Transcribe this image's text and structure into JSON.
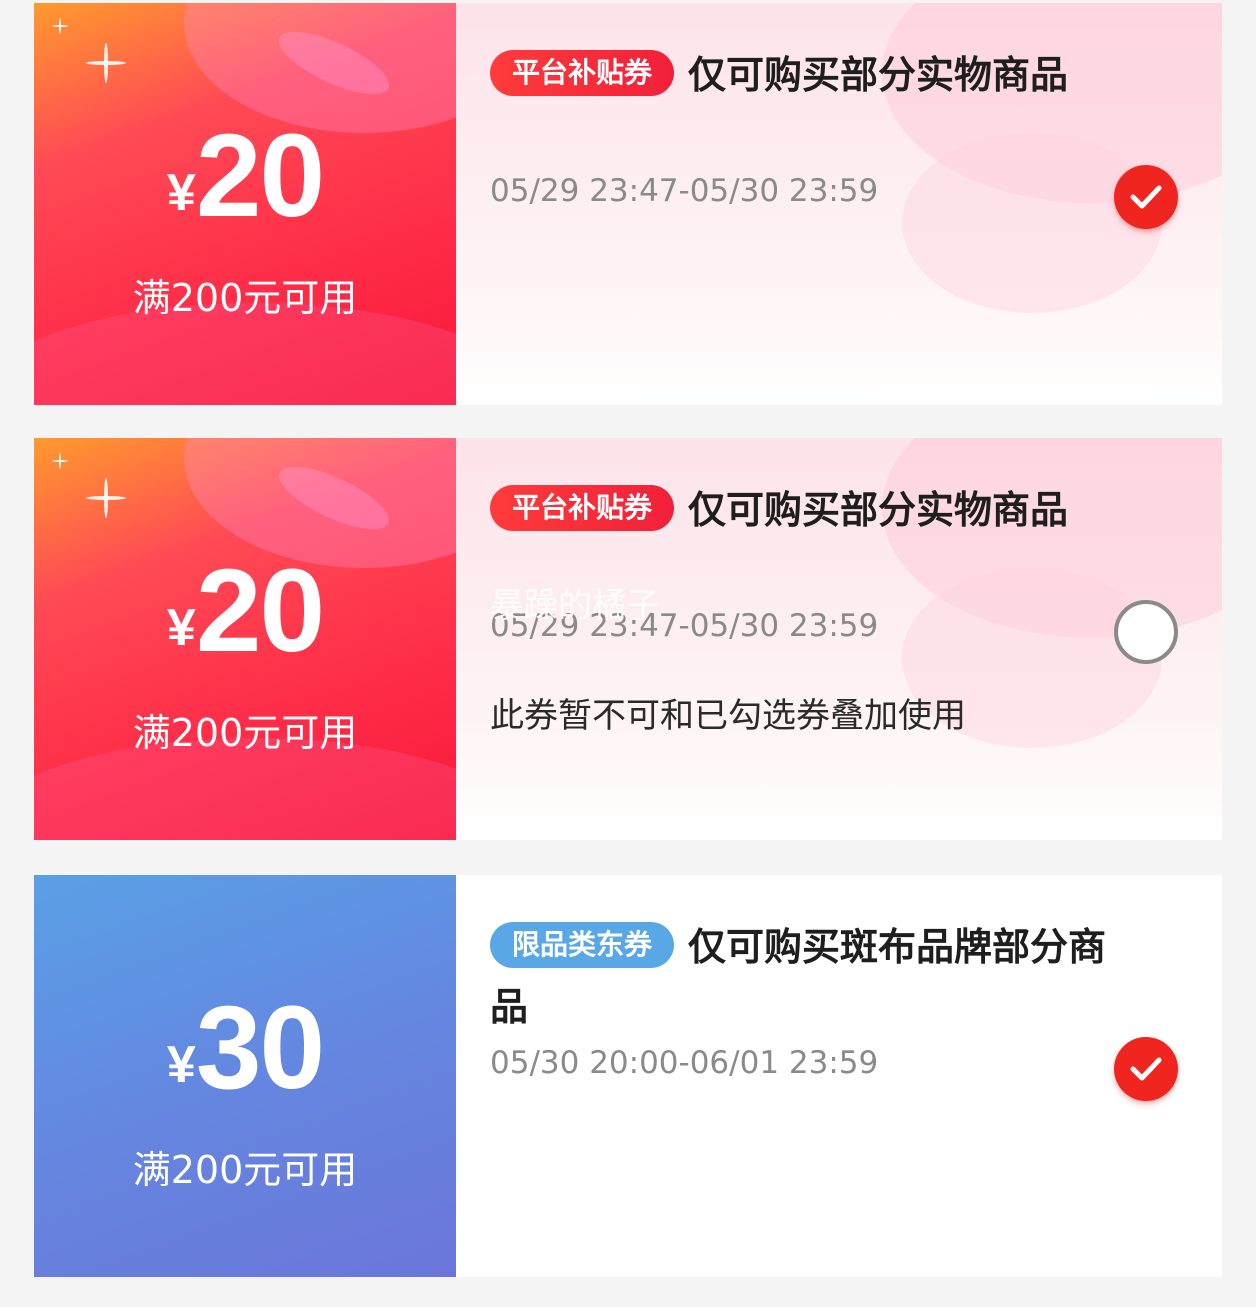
{
  "coupons": [
    {
      "currency": "¥",
      "amount": "20",
      "condition": "满200元可用",
      "tag": "平台补贴券",
      "title": "仅可购买部分实物商品",
      "validity": "05/29 23:47-05/30 23:59",
      "note": "",
      "watermark": "",
      "selected": true,
      "theme": "red"
    },
    {
      "currency": "¥",
      "amount": "20",
      "condition": "满200元可用",
      "tag": "平台补贴券",
      "title": "仅可购买部分实物商品",
      "validity": "05/29 23:47-05/30 23:59",
      "note": "此券暂不可和已勾选券叠加使用",
      "watermark": "暴躁的橘子",
      "selected": false,
      "theme": "red"
    },
    {
      "currency": "¥",
      "amount": "30",
      "condition": "满200元可用",
      "tag": "限品类东券",
      "title": "仅可购买斑布品牌部分商品",
      "validity": "05/30 20:00-06/01 23:59",
      "note": "",
      "watermark": "",
      "selected": true,
      "theme": "blue"
    }
  ],
  "colors": {
    "accent_red": "#f0251f",
    "tag_blue": "#5aa7e6",
    "coupon_blue": "#6487e0"
  }
}
